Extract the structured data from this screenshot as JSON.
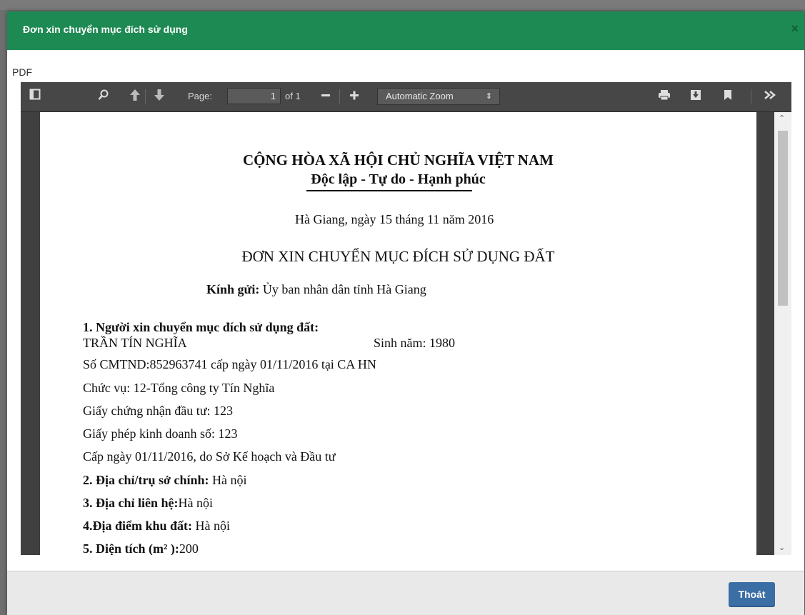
{
  "modal": {
    "title": "Đơn xin chuyển mục đích sử dụng",
    "close_glyph": "×",
    "exit_button": "Thoát"
  },
  "viewer": {
    "label": "PDF",
    "toolbar": {
      "page_label": "Page:",
      "page_value": "1",
      "page_of": "of 1",
      "zoom_value": "Automatic Zoom"
    },
    "icons": [
      "sidebar-toggle-icon",
      "search-icon",
      "previous-page-icon",
      "next-page-icon",
      "zoom-out-icon",
      "zoom-in-icon",
      "print-icon",
      "download-icon",
      "bookmark-icon",
      "tools-icon"
    ]
  },
  "document": {
    "national_title": "CỘNG HÒA XÃ HỘI CHỦ NGHĨA VIỆT NAM",
    "motto": "Độc lập - Tự do - Hạnh phúc",
    "place_date": "Hà Giang, ngày 15 tháng 11 năm 2016",
    "form_title": "ĐƠN XIN CHUYỂN MỤC ĐÍCH SỬ DỤNG ĐẤT",
    "recipient_label": "Kính gửi:",
    "recipient_value": "Ủy ban nhân dân tỉnh Hà Giang",
    "section1_title": "1. Người xin chuyển mục đích sử dụng đất:",
    "applicant_name": "TRẦN TÍN NGHĨA",
    "birth_year": "Sinh năm: 1980",
    "id_line": "Số CMTND:852963741 cấp ngày 01/11/2016 tại CA HN",
    "position_line": "Chức vụ: 12-Tổng công ty Tín Nghĩa",
    "investment_cert": "Giấy chứng nhận đầu tư: 123",
    "business_license": "Giấy phép kinh doanh số: 123",
    "issued_line": "Cấp ngày 01/11/2016, do Sở Kế hoạch và Đầu tư",
    "section2_label": "2. Địa chỉ/trụ sở chính:",
    "section2_value": "Hà nội",
    "section3_label": "3. Địa chỉ liên hệ:",
    "section3_value": "Hà nội",
    "section4_label": "4.Địa điểm khu đất:",
    "section4_value": "Hà nội",
    "section5_label": "5. Diện tích (m² ):",
    "section5_value": "200"
  }
}
